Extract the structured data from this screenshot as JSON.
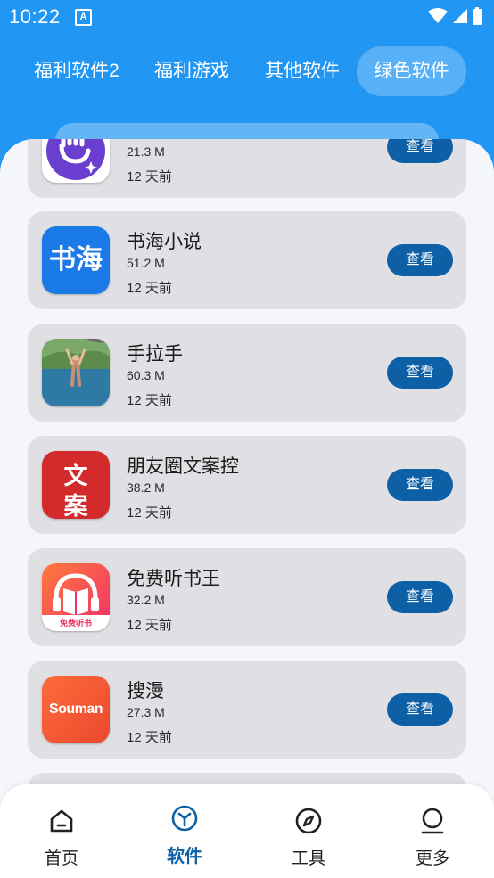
{
  "status_bar": {
    "time": "10:22",
    "badge": "A"
  },
  "tabs": [
    {
      "label": "福利软件2",
      "active": false
    },
    {
      "label": "福利游戏",
      "active": false
    },
    {
      "label": "其他软件",
      "active": false
    },
    {
      "label": "绿色软件",
      "active": true
    }
  ],
  "apps": [
    {
      "name": "",
      "size": "21.3 M",
      "time": "12 天前",
      "button": "查看",
      "icon": "hand-sparkle-icon"
    },
    {
      "name": "书海小说",
      "size": "51.2 M",
      "time": "12 天前",
      "button": "查看",
      "icon": "shuhai-icon",
      "icon_text": "书海"
    },
    {
      "name": "手拉手",
      "size": "60.3 M",
      "time": "12 天前",
      "button": "查看",
      "icon": "photo-person-icon"
    },
    {
      "name": "朋友圈文案控",
      "size": "38.2 M",
      "time": "12 天前",
      "button": "查看",
      "icon": "wenan-icon",
      "icon_text_1": "文",
      "icon_text_2": "案"
    },
    {
      "name": "免费听书王",
      "size": "32.2 M",
      "time": "12 天前",
      "button": "查看",
      "icon": "headphone-book-icon",
      "icon_text": "免费听书"
    },
    {
      "name": "搜漫",
      "size": "27.3 M",
      "time": "12 天前",
      "button": "查看",
      "icon": "souman-icon",
      "icon_text": "Souman"
    }
  ],
  "bottom_nav": [
    {
      "label": "首页",
      "icon": "home-icon",
      "active": false
    },
    {
      "label": "软件",
      "icon": "cube-icon",
      "active": true
    },
    {
      "label": "工具",
      "icon": "compass-icon",
      "active": false
    },
    {
      "label": "更多",
      "icon": "person-icon",
      "active": false
    }
  ],
  "colors": {
    "primary": "#2196f3",
    "button": "#0d5fa6",
    "card": "#e0e0e4"
  }
}
